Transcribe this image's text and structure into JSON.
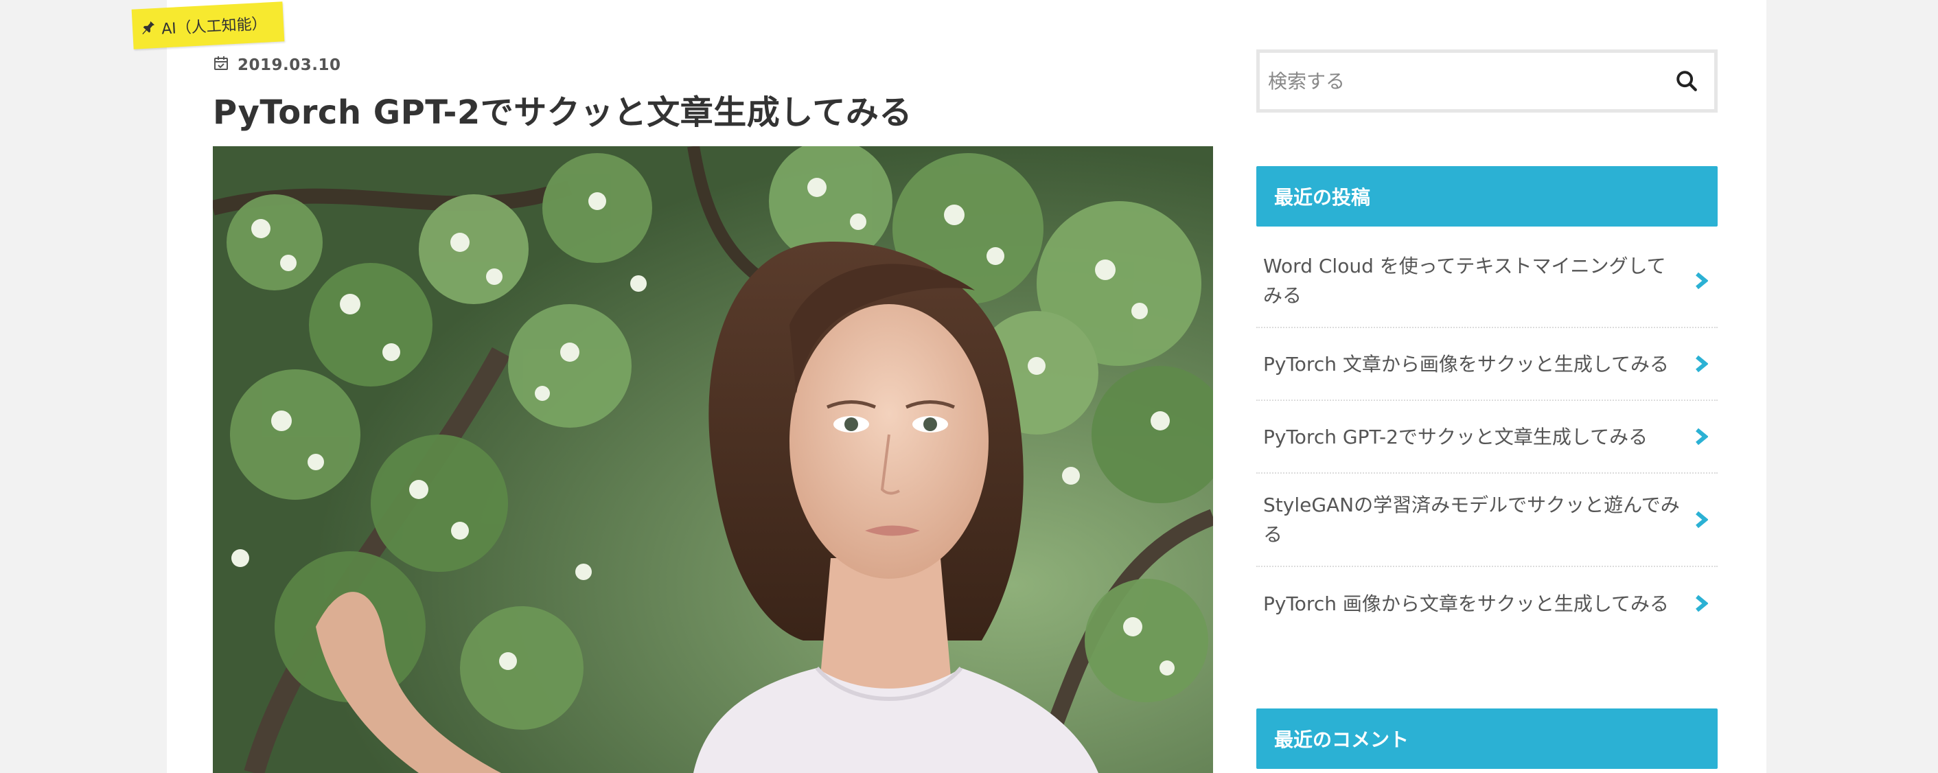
{
  "category_tag": {
    "label": "AI（人工知能）",
    "icon": "pin-icon",
    "color": "#f7e92f"
  },
  "post": {
    "date": "2019.03.10",
    "date_icon": "calendar-check-icon",
    "title": "PyTorch GPT-2でサクッと文章生成してみる",
    "hero_image": "woman-among-blossoms-photo"
  },
  "sidebar": {
    "search": {
      "placeholder": "検索する",
      "icon": "search-icon"
    },
    "recent_posts": {
      "title": "最近の投稿",
      "items": [
        {
          "label": "Word Cloud を使ってテキストマイニングしてみる"
        },
        {
          "label": "PyTorch 文章から画像をサクッと生成してみる"
        },
        {
          "label": "PyTorch GPT-2でサクッと文章生成してみる"
        },
        {
          "label": "StyleGANの学習済みモデルでサクッと遊んでみる"
        },
        {
          "label": "PyTorch 画像から文章をサクッと生成してみる"
        }
      ],
      "item_icon": "chevron-right-icon"
    },
    "recent_comments": {
      "title": "最近のコメント"
    },
    "accent_color": "#2bb1d4"
  }
}
